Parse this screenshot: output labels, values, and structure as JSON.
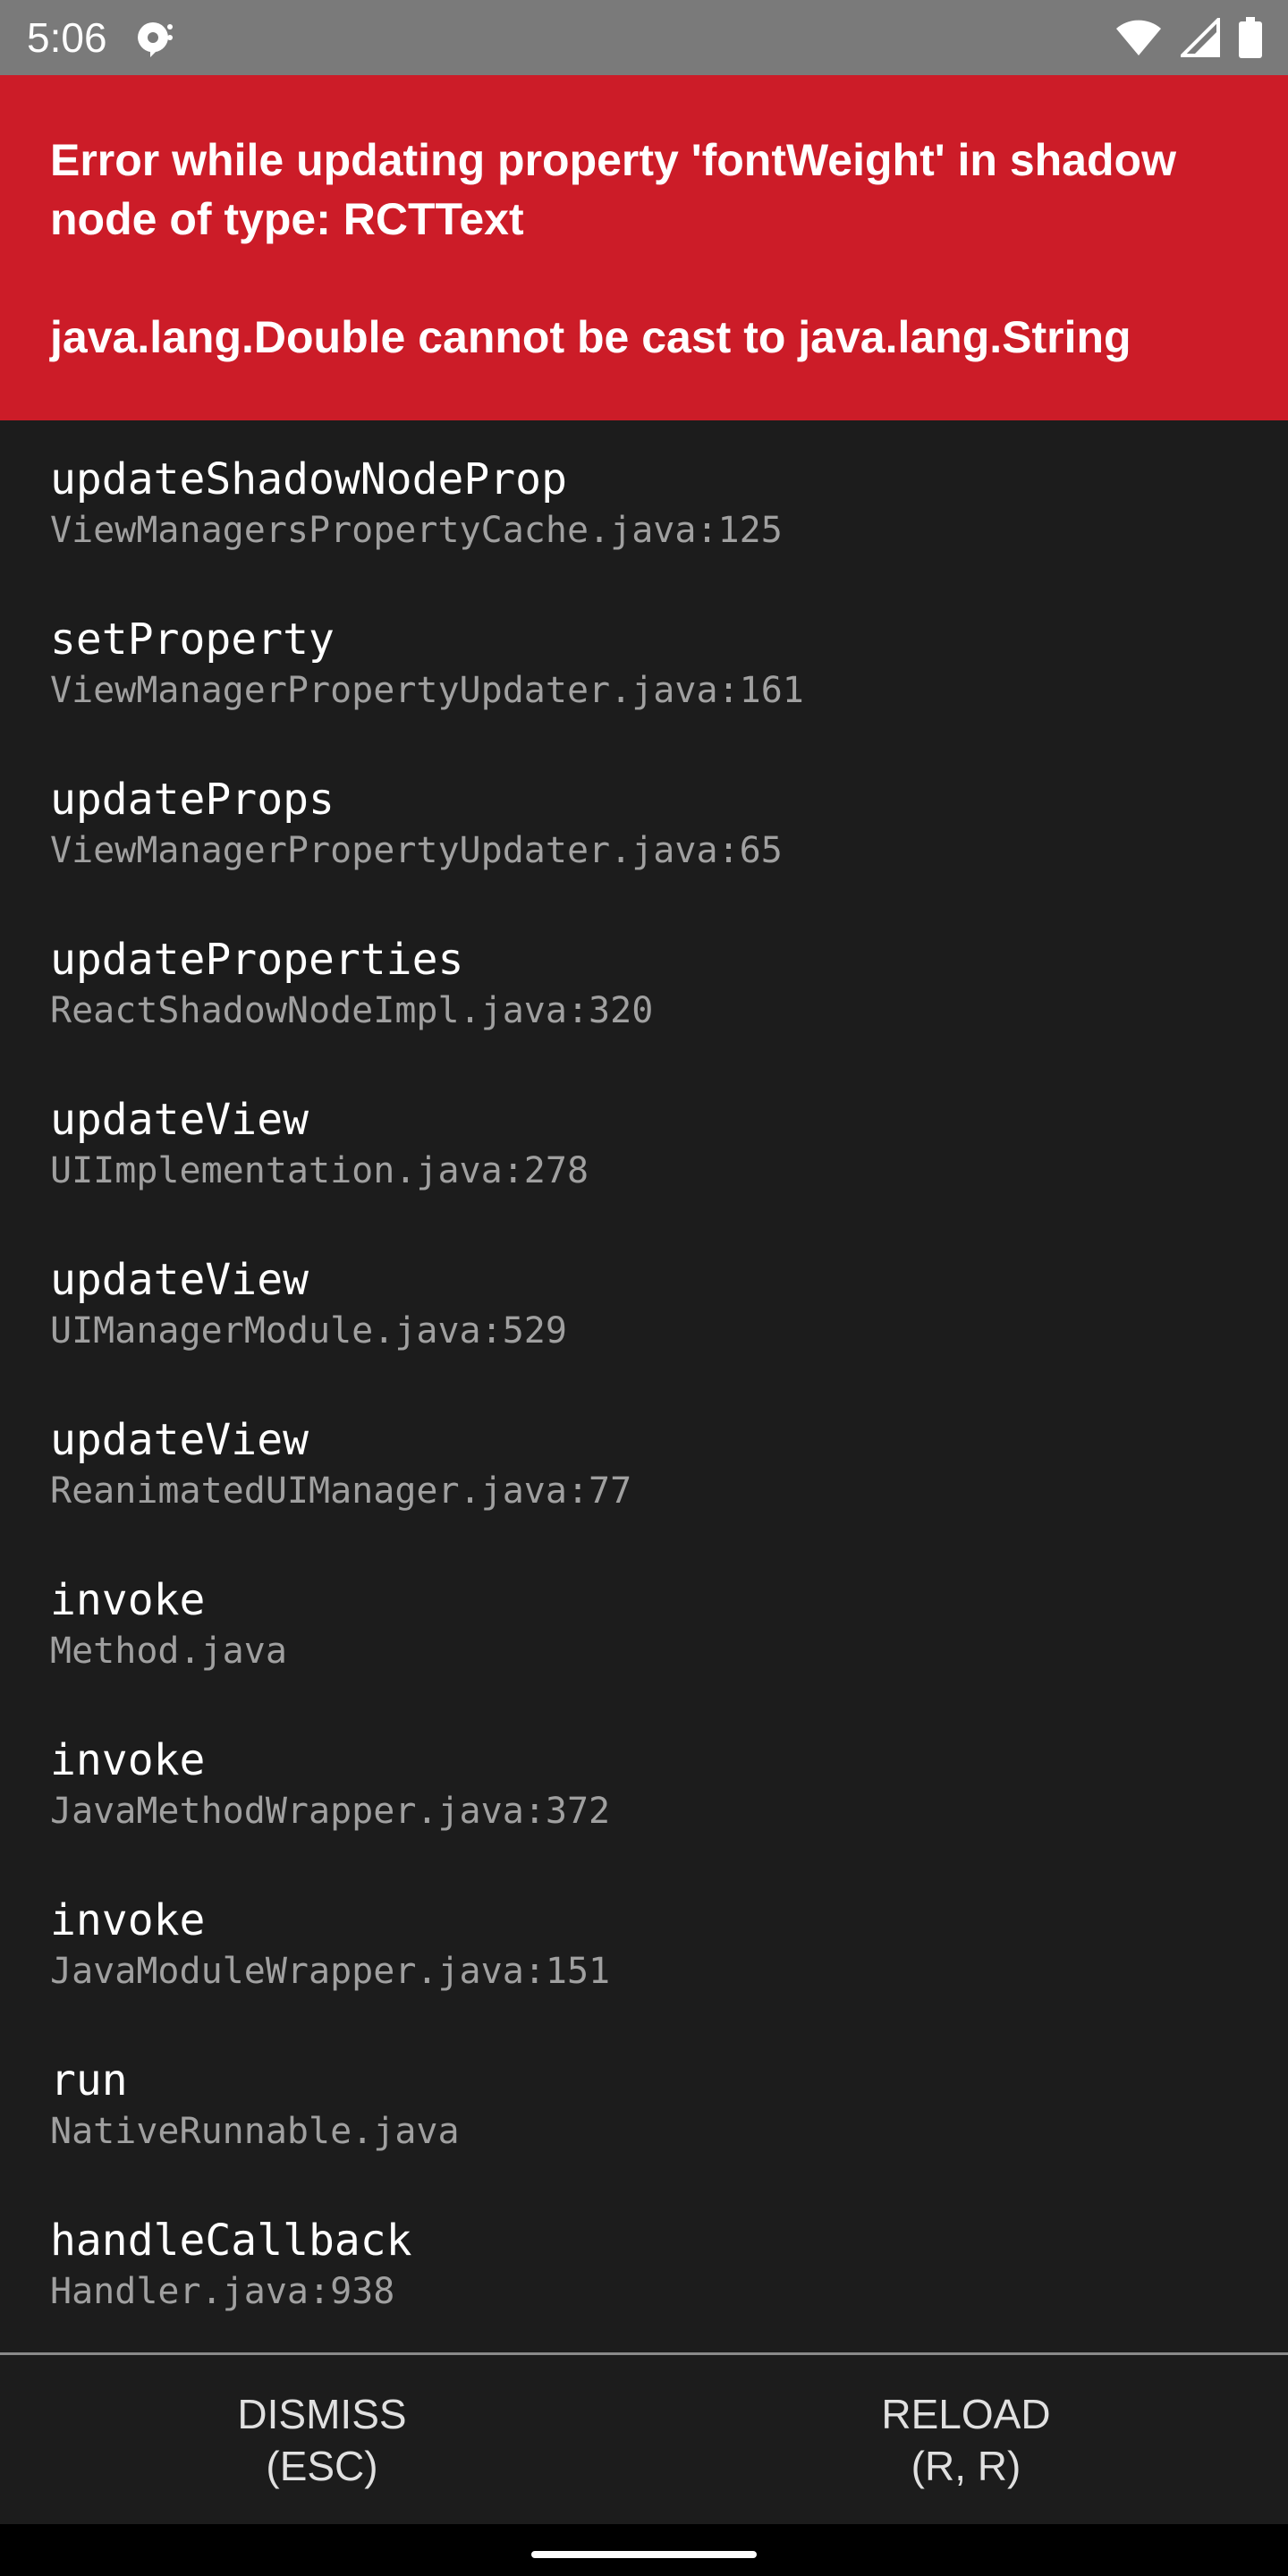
{
  "status_bar": {
    "time": "5:06",
    "icons": [
      "notification-icon",
      "wifi-icon",
      "signal-icon",
      "battery-icon"
    ],
    "background": "#7a7a7a"
  },
  "error": {
    "message_line1": "Error while updating property 'fontWeight' in shadow",
    "message_line2": "node of type: RCTText",
    "exception": "java.lang.Double cannot be cast to java.lang.String",
    "background": "#cc1c28"
  },
  "stack": [
    {
      "method": "updateShadowNodeProp",
      "file": "ViewManagersPropertyCache.java:125"
    },
    {
      "method": "setProperty",
      "file": "ViewManagerPropertyUpdater.java:161"
    },
    {
      "method": "updateProps",
      "file": "ViewManagerPropertyUpdater.java:65"
    },
    {
      "method": "updateProperties",
      "file": "ReactShadowNodeImpl.java:320"
    },
    {
      "method": "updateView",
      "file": "UIImplementation.java:278"
    },
    {
      "method": "updateView",
      "file": "UIManagerModule.java:529"
    },
    {
      "method": "updateView",
      "file": "ReanimatedUIManager.java:77"
    },
    {
      "method": "invoke",
      "file": "Method.java"
    },
    {
      "method": "invoke",
      "file": "JavaMethodWrapper.java:372"
    },
    {
      "method": "invoke",
      "file": "JavaModuleWrapper.java:151"
    },
    {
      "method": "run",
      "file": "NativeRunnable.java"
    },
    {
      "method": "handleCallback",
      "file": "Handler.java:938"
    }
  ],
  "buttons": {
    "dismiss": {
      "label": "DISMISS",
      "shortcut": "(ESC)"
    },
    "reload": {
      "label": "RELOAD",
      "shortcut": "(R, R)"
    }
  }
}
